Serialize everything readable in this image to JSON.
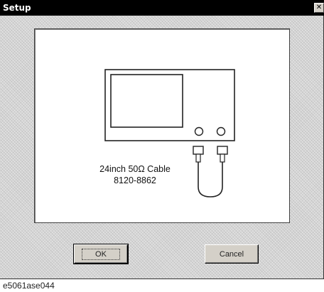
{
  "window": {
    "title": "Setup",
    "close_glyph": "✕"
  },
  "diagram": {
    "cable_label_line1": "24inch 50Ω Cable",
    "cable_label_line2": "8120-8862"
  },
  "buttons": {
    "ok_label": "OK",
    "cancel_label": "Cancel"
  },
  "caption": "e5061ase044",
  "colors": {
    "titlebar": "#000000",
    "title_text": "#ffffff",
    "panel": "#ffffff",
    "dialog_face": "#d4d0c8"
  }
}
